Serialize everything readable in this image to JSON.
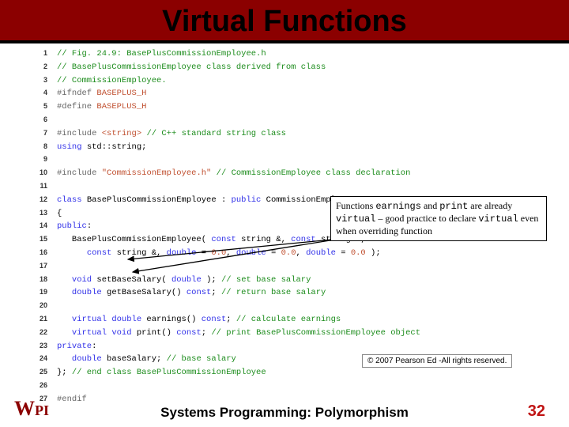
{
  "header": {
    "title": "Virtual Functions"
  },
  "code": {
    "lines": [
      {
        "n": 1,
        "h": "<span class='cmt'>// Fig. 24.9: BasePlusCommissionEmployee.h</span>"
      },
      {
        "n": 2,
        "h": "<span class='cmt'>// BasePlusCommissionEmployee class derived from class</span>"
      },
      {
        "n": 3,
        "h": "<span class='cmt'>// CommissionEmployee.</span>"
      },
      {
        "n": 4,
        "h": "<span class='prep'>#ifndef</span> <span class='str'>BASEPLUS_H</span>"
      },
      {
        "n": 5,
        "h": "<span class='prep'>#define</span> <span class='str'>BASEPLUS_H</span>"
      },
      {
        "n": 6,
        "h": ""
      },
      {
        "n": 7,
        "h": "<span class='prep'>#include</span> <span class='str'>&lt;string&gt;</span> <span class='cmt'>// C++ standard string class</span>"
      },
      {
        "n": 8,
        "h": "<span class='kw'>using</span> std::string;"
      },
      {
        "n": 9,
        "h": ""
      },
      {
        "n": 10,
        "h": "<span class='prep'>#include</span> <span class='str'>\"CommissionEmployee.h\"</span> <span class='cmt'>// CommissionEmployee class declaration</span>"
      },
      {
        "n": 11,
        "h": ""
      },
      {
        "n": 12,
        "h": "<span class='kw'>class</span> BasePlusCommissionEmployee : <span class='kw'>public</span> CommissionEmployee"
      },
      {
        "n": 13,
        "h": "{"
      },
      {
        "n": 14,
        "h": "<span class='kw'>public</span>:"
      },
      {
        "n": 15,
        "h": "   BasePlusCommissionEmployee( <span class='kw'>const</span> string &amp;, <span class='kw'>const</span> string &amp;,"
      },
      {
        "n": 16,
        "h": "      <span class='kw'>const</span> string &amp;, <span class='kw'>double</span> = <span class='str'>0.0</span>, <span class='kw'>double</span> = <span class='str'>0.0</span>, <span class='kw'>double</span> = <span class='str'>0.0</span> );"
      },
      {
        "n": 17,
        "h": ""
      },
      {
        "n": 18,
        "h": "   <span class='kw'>void</span> setBaseSalary( <span class='kw'>double</span> ); <span class='cmt'>// set base salary</span>"
      },
      {
        "n": 19,
        "h": "   <span class='kw'>double</span> getBaseSalary() <span class='kw'>const</span>; <span class='cmt'>// return base salary</span>"
      },
      {
        "n": 20,
        "h": ""
      },
      {
        "n": 21,
        "h": "   <span class='kw'>virtual double</span> earnings() <span class='kw'>const</span>; <span class='cmt'>// calculate earnings</span>"
      },
      {
        "n": 22,
        "h": "   <span class='kw'>virtual void</span> print() <span class='kw'>const</span>; <span class='cmt'>// print BasePlusCommissionEmployee object</span>"
      },
      {
        "n": 23,
        "h": "<span class='kw'>private</span>:"
      },
      {
        "n": 24,
        "h": "   <span class='kw'>double</span> baseSalary; <span class='cmt'>// base salary</span>"
      },
      {
        "n": 25,
        "h": "}; <span class='cmt'>// end class BasePlusCommissionEmployee</span>"
      },
      {
        "n": 26,
        "h": ""
      },
      {
        "n": 27,
        "h": "<span class='prep'>#endif</span>"
      }
    ]
  },
  "callout": {
    "pre": "Functions ",
    "m1": "earnings",
    "mid1": " and ",
    "m2": "print",
    "mid2": " are already ",
    "m3": "virtual",
    "mid3": " – good practice to declare ",
    "m4": "virtual",
    "post": " even when overriding function"
  },
  "copyright": "© 2007 Pearson Ed -All rights reserved.",
  "footer": {
    "logo_main": "W",
    "logo_rest": "PI",
    "center": "Systems Programming:  Polymorphism",
    "page": "32"
  }
}
